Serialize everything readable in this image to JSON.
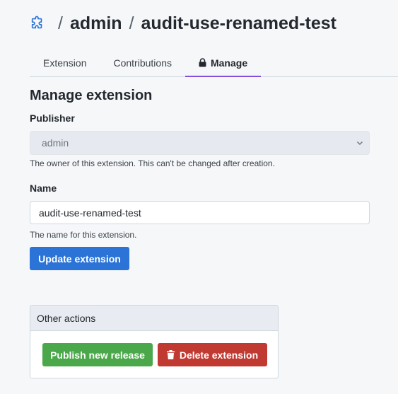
{
  "breadcrumb": {
    "icon": "puzzle-icon",
    "separator": "/",
    "publisher": "admin",
    "extension": "audit-use-renamed-test"
  },
  "tabs": [
    {
      "label": "Extension",
      "active": false
    },
    {
      "label": "Contributions",
      "active": false
    },
    {
      "label": "Manage",
      "active": true,
      "icon": "lock-icon"
    }
  ],
  "manage": {
    "title": "Manage extension",
    "publisher": {
      "label": "Publisher",
      "selected": "admin",
      "help": "The owner of this extension. This can't be changed after creation."
    },
    "name": {
      "label": "Name",
      "value": "audit-use-renamed-test",
      "help": "The name for this extension."
    },
    "update_button": "Update extension"
  },
  "other_actions": {
    "title": "Other actions",
    "publish_button": "Publish new release",
    "delete_button": "Delete extension",
    "delete_icon": "trash-icon"
  },
  "colors": {
    "primary": "#2b73d6",
    "success": "#4aa84a",
    "danger": "#c03a32",
    "tab_accent": "#8250df",
    "breadcrumb_icon": "#2b73d6"
  }
}
